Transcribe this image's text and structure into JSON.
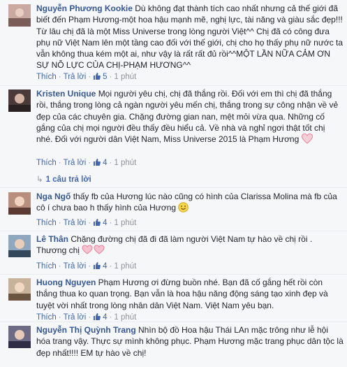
{
  "comments": [
    {
      "author": "Nguyễn Phương Kookie",
      "text": "Dù không đạt thành tích cao nhất nhưng cả thế giới đã biết đến Phạm Hương-một hoa hậu mạnh mẽ, nghị lực, tài năng và giàu sắc đẹp!!! Từ lâu chị đã là một Miss Universe trong lòng người Việt^^ Chị đã có công đưa phụ nữ Việt Nam lên một tầng cao đối với thế giới, chị cho họ thấy phụ nữ nước ta vẫn không thua kém một ai, như vậy là rất rất đủ rồi^^MỘT LẦN NỮA CẢM ƠN SỰ NỖ LỰC CỦA CHỊ-PHẠM HƯƠNG^^",
      "like_label": "Thích",
      "reply_label": "Trả lời",
      "like_count": "5",
      "time": "1 phút"
    },
    {
      "author": "Kristen Unique",
      "text": "Mọi người yêu chị, chị đã thắng rồi. Đối với em thì chị đã thắng rồi, thắng trong lòng cả ngàn người yêu mến chị, thắng trong sự công nhận về vẻ đẹp của các chuyên gia. Chặng đường gian nan, mệt mỏi vừa qua. Những cố gắng của chị mọi người đều thấy đều hiểu cả. Về nhà và nghỉ ngơi thật tốt chị nhé. Đối với người dân Việt Nam, Miss Universe 2015 là Phạm Hương",
      "like_label": "Thích",
      "reply_label": "Trả lời",
      "like_count": "4",
      "time": "1 phút",
      "replies_label": "1 câu trả lời"
    },
    {
      "author": "Nga Ngố",
      "text": "thấy fb của Hương lúc nào cũng có hình của Clarissa Molina mà fb của cô í chưa bao h thấy hình của Hương",
      "like_label": "Thích",
      "reply_label": "Trả lời",
      "like_count": "4",
      "time": "1 phút"
    },
    {
      "author": "Lê Thân",
      "text": "Chặng đường chị đã đi đã làm người Việt Nam tự hào về chị rồi . Thương chị",
      "like_label": "Thích",
      "reply_label": "Trả lời",
      "like_count": "4",
      "time": "1 phút"
    },
    {
      "author": "Huong Nguyen",
      "text": "Phạm Hương ơi đừng buồn nhé. Bạn đã cố gắng hết rồi còn thắng thua ko quan trọng. Bạn vẫn là hoa hậu năng động sáng tạo xinh đẹp và tuyệt vời nhất trong lòng nhân dân Việt Nam. Việt Nam yêu bạn.",
      "like_label": "Thích",
      "reply_label": "Trả lời",
      "like_count": "4",
      "time": "1 phút"
    },
    {
      "author": "Nguyễn Thị Quỳnh Trang",
      "text": "Nhìn bộ đồ Hoa hậu Thái LAn mặc trông như lễ hội hóa trang vậy. Thực sự mình không phục. Phạm Hương mặc trang phục dân tộc là đẹp nhất!!!! EM tự hào về chị!"
    }
  ],
  "colors": {
    "link": "#365899",
    "action": "#4267b2",
    "meta": "#90949c",
    "bg": "#f6f7f9"
  },
  "icons": {
    "like": "thumbs-up-icon",
    "heart": "heart-emoji-icon",
    "smile": "smile-emoji-icon",
    "reply_arrow": "reply-arrow-icon"
  }
}
